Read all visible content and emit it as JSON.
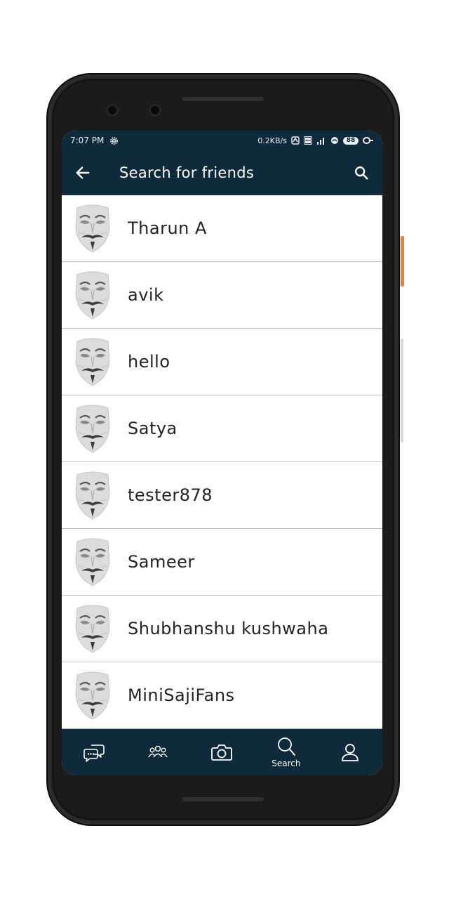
{
  "status_bar": {
    "time": "7:07 PM",
    "network_speed": "0.2KB/s",
    "battery": "88"
  },
  "app_bar": {
    "title": "Search for friends"
  },
  "friends": [
    {
      "name": "Tharun A"
    },
    {
      "name": "avik"
    },
    {
      "name": "hello"
    },
    {
      "name": "Satya"
    },
    {
      "name": "tester878"
    },
    {
      "name": "Sameer"
    },
    {
      "name": "Shubhanshu kushwaha"
    },
    {
      "name": "MiniSajiFans"
    }
  ],
  "bottom_nav": {
    "search_label": "Search"
  },
  "colors": {
    "primary": "#0e2a3b",
    "divider": "#bdbdbd"
  }
}
